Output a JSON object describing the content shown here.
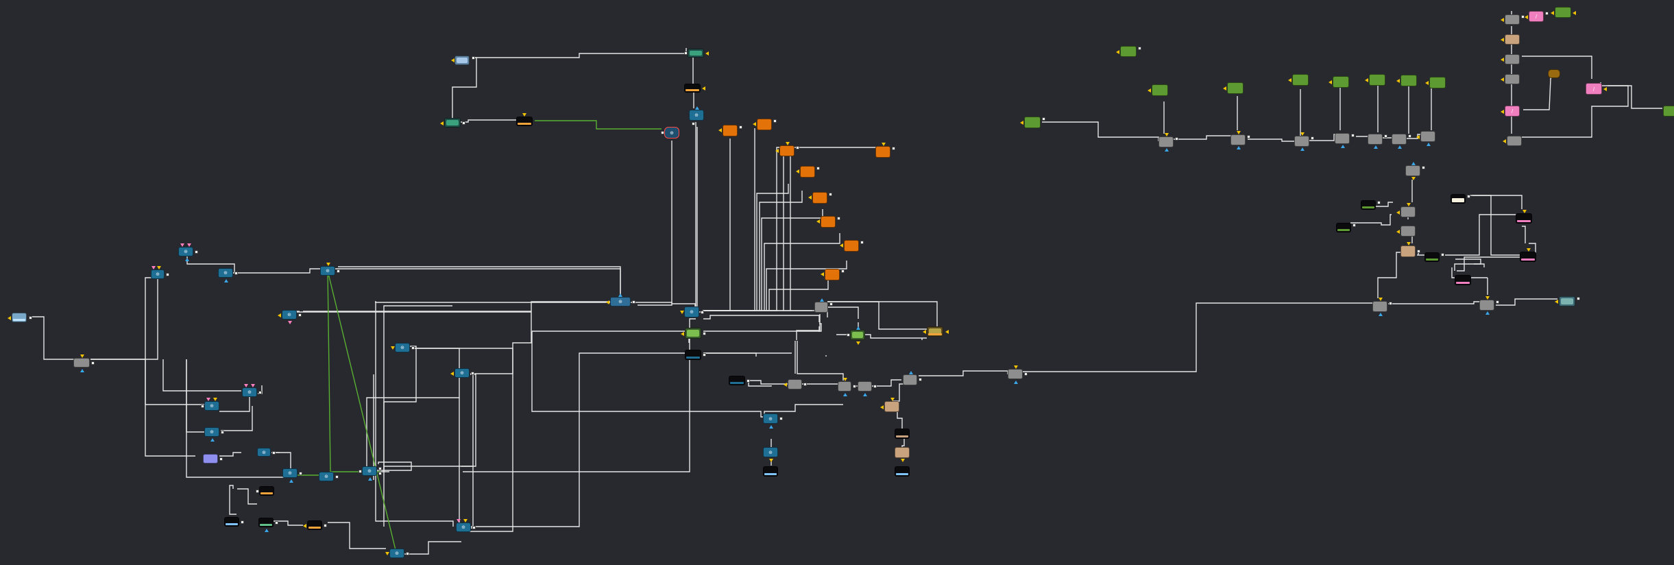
{
  "app": {
    "view": "node-editor"
  },
  "colors": {
    "background": "#28282f",
    "wire": "#e6e6e6",
    "wire_green": "#58b030",
    "node_blue": "#1f6e94",
    "node_gray": "#8e8e8e",
    "node_orange": "#e37208",
    "node_green": "#5e9a32",
    "node_tan": "#c9a27e",
    "node_pink": "#f07fc0",
    "node_black": "#0b0b0e",
    "node_lavender": "#8f8ff0",
    "input_triangle": "#f2c400",
    "output_triangle": "#39a6e8",
    "mask_triangle": "#ff7fbf",
    "selected_outline": "#ff4a4a"
  },
  "node_types": {
    "blue": "transform",
    "gray": "merge",
    "orange": "shape",
    "green": "source",
    "tan": "tool",
    "pink": "brightness-contrast",
    "black": "loader",
    "lavender": "background",
    "thumb": "image"
  },
  "nodes": [
    {
      "id": "n_l1",
      "type": "thumb"
    },
    {
      "id": "n_l2",
      "type": "gray"
    },
    {
      "id": "n_l3",
      "type": "blue"
    },
    {
      "id": "n_l4",
      "type": "blue"
    },
    {
      "id": "n_l5",
      "type": "blue"
    },
    {
      "id": "n_l6",
      "type": "blue"
    },
    {
      "id": "n_l7",
      "type": "blue"
    },
    {
      "id": "n_l8",
      "type": "blue"
    },
    {
      "id": "n_l9",
      "type": "blue"
    },
    {
      "id": "n_l10",
      "type": "lavender"
    },
    {
      "id": "n_l11",
      "type": "blue"
    },
    {
      "id": "n_l12",
      "type": "blue"
    },
    {
      "id": "n_l13",
      "type": "blue"
    },
    {
      "id": "n_l14",
      "type": "blue"
    },
    {
      "id": "n_l15",
      "type": "blue"
    },
    {
      "id": "n_l16",
      "type": "blue"
    },
    {
      "id": "n_l17",
      "type": "blue"
    },
    {
      "id": "n_l18",
      "type": "blue"
    },
    {
      "id": "n_l19",
      "type": "black"
    },
    {
      "id": "n_l20",
      "type": "black"
    },
    {
      "id": "n_l21",
      "type": "black"
    },
    {
      "id": "n_l22",
      "type": "black"
    },
    {
      "id": "n_t1",
      "type": "thumb"
    },
    {
      "id": "n_t2",
      "type": "thumb"
    },
    {
      "id": "n_t3",
      "type": "thumb"
    },
    {
      "id": "n_t4",
      "type": "black"
    },
    {
      "id": "n_t5",
      "type": "black"
    },
    {
      "id": "n_t6",
      "type": "blue",
      "selected": true
    },
    {
      "id": "n_t7",
      "type": "blue"
    },
    {
      "id": "n_c1",
      "type": "blue"
    },
    {
      "id": "n_c2",
      "type": "blue"
    },
    {
      "id": "n_c3",
      "type": "thumb"
    },
    {
      "id": "n_c4",
      "type": "black"
    },
    {
      "id": "n_o1",
      "type": "orange"
    },
    {
      "id": "n_o2",
      "type": "orange"
    },
    {
      "id": "n_o3",
      "type": "orange"
    },
    {
      "id": "n_o4",
      "type": "orange"
    },
    {
      "id": "n_o5",
      "type": "orange"
    },
    {
      "id": "n_o6",
      "type": "orange"
    },
    {
      "id": "n_o7",
      "type": "orange"
    },
    {
      "id": "n_o8",
      "type": "orange"
    },
    {
      "id": "n_o9",
      "type": "orange"
    },
    {
      "id": "n_m1",
      "type": "gray"
    },
    {
      "id": "n_m2",
      "type": "thumb"
    },
    {
      "id": "n_m3",
      "type": "thumb"
    },
    {
      "id": "n_m4",
      "type": "black"
    },
    {
      "id": "n_m5",
      "type": "gray"
    },
    {
      "id": "n_m6",
      "type": "gray"
    },
    {
      "id": "n_m7",
      "type": "gray"
    },
    {
      "id": "n_m8",
      "type": "gray"
    },
    {
      "id": "n_m9",
      "type": "gray"
    },
    {
      "id": "n_m10",
      "type": "tan"
    },
    {
      "id": "n_m11",
      "type": "black"
    },
    {
      "id": "n_m12",
      "type": "tan"
    },
    {
      "id": "n_m13",
      "type": "black"
    },
    {
      "id": "n_m14",
      "type": "blue"
    },
    {
      "id": "n_m15",
      "type": "blue"
    },
    {
      "id": "n_m16",
      "type": "black"
    },
    {
      "id": "n_r1",
      "type": "green"
    },
    {
      "id": "n_r2",
      "type": "green"
    },
    {
      "id": "n_r3",
      "type": "green"
    },
    {
      "id": "n_r4",
      "type": "green"
    },
    {
      "id": "n_r5",
      "type": "green"
    },
    {
      "id": "n_r6",
      "type": "green"
    },
    {
      "id": "n_r7",
      "type": "green"
    },
    {
      "id": "n_r8",
      "type": "green"
    },
    {
      "id": "n_r9",
      "type": "green"
    },
    {
      "id": "n_r10",
      "type": "gray"
    },
    {
      "id": "n_r11",
      "type": "gray"
    },
    {
      "id": "n_r12",
      "type": "gray"
    },
    {
      "id": "n_r13",
      "type": "gray"
    },
    {
      "id": "n_r14",
      "type": "gray"
    },
    {
      "id": "n_r15",
      "type": "gray"
    },
    {
      "id": "n_r16",
      "type": "gray"
    },
    {
      "id": "n_k1",
      "type": "gray"
    },
    {
      "id": "n_k2",
      "type": "pink"
    },
    {
      "id": "n_k3",
      "type": "green"
    },
    {
      "id": "n_k4",
      "type": "tan"
    },
    {
      "id": "n_k5",
      "type": "gray"
    },
    {
      "id": "n_k6",
      "type": "gray"
    },
    {
      "id": "n_k7",
      "type": "tan"
    },
    {
      "id": "n_k8",
      "type": "pink"
    },
    {
      "id": "n_k9",
      "type": "gray"
    },
    {
      "id": "n_k10",
      "type": "pink"
    },
    {
      "id": "n_k11",
      "type": "green"
    },
    {
      "id": "n_s1",
      "type": "gray"
    },
    {
      "id": "n_s2",
      "type": "black"
    },
    {
      "id": "n_s3",
      "type": "gray"
    },
    {
      "id": "n_s4",
      "type": "black"
    },
    {
      "id": "n_s5",
      "type": "gray"
    },
    {
      "id": "n_s6",
      "type": "tan"
    },
    {
      "id": "n_s7",
      "type": "black"
    },
    {
      "id": "n_s8",
      "type": "black"
    },
    {
      "id": "n_s9",
      "type": "black"
    },
    {
      "id": "n_s10",
      "type": "black"
    },
    {
      "id": "n_s11",
      "type": "black"
    },
    {
      "id": "n_s12",
      "type": "gray"
    },
    {
      "id": "n_s13",
      "type": "gray"
    },
    {
      "id": "n_s14",
      "type": "thumb"
    }
  ]
}
